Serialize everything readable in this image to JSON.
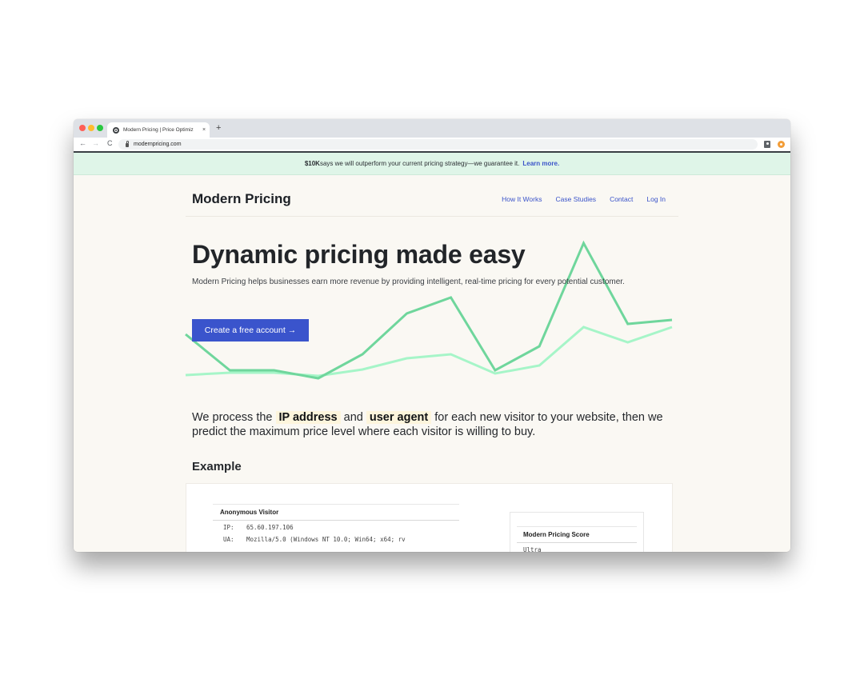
{
  "browser": {
    "tab_title": "Modern Pricing | Price Optimiz",
    "tab_close": "×",
    "new_tab": "+",
    "nav_back": "←",
    "nav_forward": "→",
    "nav_reload": "C",
    "url": "modernpricing.com"
  },
  "banner": {
    "bold": "$10K",
    "text": " says we will outperform your current pricing strategy—we guarantee it.",
    "link": "Learn more."
  },
  "header": {
    "brand": "Modern Pricing",
    "nav": [
      "How It Works",
      "Case Studies",
      "Contact",
      "Log In"
    ]
  },
  "hero": {
    "title": "Dynamic pricing made easy",
    "subtitle": "Modern Pricing helps businesses earn more revenue by providing intelligent, real-time pricing for every potential customer.",
    "cta": "Create a free account →"
  },
  "chart_data": {
    "type": "line",
    "title": "",
    "xlabel": "",
    "ylabel": "",
    "grid": false,
    "legend": "none",
    "x": [
      0,
      1,
      2,
      3,
      4,
      5,
      6,
      7,
      8,
      9,
      10,
      11
    ],
    "ylim": [
      0,
      180
    ],
    "series": [
      {
        "name": "dark",
        "color": "#6fd69c",
        "values": [
          62,
          17,
          17,
          7,
          37,
          88,
          108,
          17,
          47,
          176,
          75,
          80
        ]
      },
      {
        "name": "light",
        "color": "#a6f5c8",
        "values": [
          11,
          14,
          14,
          10,
          18,
          32,
          37,
          13,
          23,
          71,
          52,
          71
        ]
      }
    ]
  },
  "intro": {
    "p1": "We process the ",
    "hl1": "IP address",
    "p2": " and ",
    "hl2": "user agent",
    "p3": " for each new visitor to your website, then we predict the maximum price level where each visitor is willing to buy."
  },
  "example": {
    "heading": "Example",
    "visitor_title": "Anonymous Visitor",
    "ip_label": "IP:",
    "ip_value": "65.60.197.106",
    "ua_label": "UA:",
    "ua_value": "Mozilla/5.0 (Windows NT 10.0; Win64; x64; rv",
    "score_title": "Modern Pricing Score",
    "score_value": "Ultra"
  }
}
